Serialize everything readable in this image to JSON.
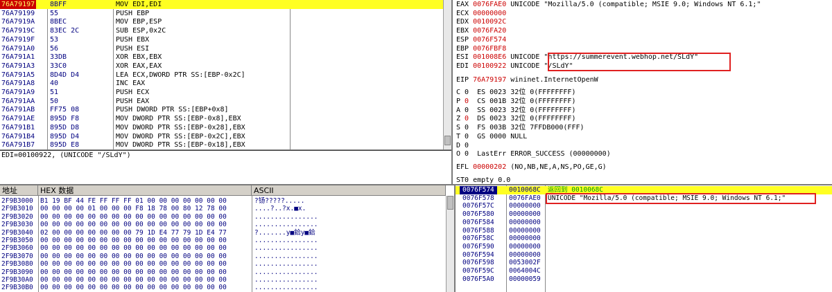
{
  "disasm": {
    "rows": [
      {
        "addr": "76A79197",
        "hex": "8BFF",
        "asm": "MOV EDI,EDI",
        "selected": true
      },
      {
        "addr": "76A79199",
        "hex": "55",
        "asm": "PUSH EBP"
      },
      {
        "addr": "76A7919A",
        "hex": "8BEC",
        "asm": "MOV EBP,ESP"
      },
      {
        "addr": "76A7919C",
        "hex": "83EC 2C",
        "asm": "SUB ESP,0x2C"
      },
      {
        "addr": "76A7919F",
        "hex": "53",
        "asm": "PUSH EBX"
      },
      {
        "addr": "76A791A0",
        "hex": "56",
        "asm": "PUSH ESI"
      },
      {
        "addr": "76A791A1",
        "hex": "33DB",
        "asm": "XOR EBX,EBX"
      },
      {
        "addr": "76A791A3",
        "hex": "33C0",
        "asm": "XOR EAX,EAX"
      },
      {
        "addr": "76A791A5",
        "hex": "8D4D D4",
        "asm": "LEA ECX,DWORD PTR SS:[EBP-0x2C]"
      },
      {
        "addr": "76A791A8",
        "hex": "40",
        "asm": "INC EAX"
      },
      {
        "addr": "76A791A9",
        "hex": "51",
        "asm": "PUSH ECX"
      },
      {
        "addr": "76A791AA",
        "hex": "50",
        "asm": "PUSH EAX"
      },
      {
        "addr": "76A791AB",
        "hex": "FF75 08",
        "asm": "PUSH DWORD PTR SS:[EBP+0x8]"
      },
      {
        "addr": "76A791AE",
        "hex": "895D F8",
        "asm": "MOV DWORD PTR SS:[EBP-0x8],EBX"
      },
      {
        "addr": "76A791B1",
        "hex": "895D D8",
        "asm": "MOV DWORD PTR SS:[EBP-0x28],EBX"
      },
      {
        "addr": "76A791B4",
        "hex": "895D D4",
        "asm": "MOV DWORD PTR SS:[EBP-0x2C],EBX"
      },
      {
        "addr": "76A791B7",
        "hex": "895D E8",
        "asm": "MOV DWORD PTR SS:[EBP-0x18],EBX"
      }
    ]
  },
  "info": {
    "text": "EDI=00100922, (UNICODE \"/SLdY\")"
  },
  "registers": {
    "regs": [
      {
        "name": "EAX",
        "value": "0076FAE0",
        "comment": "UNICODE \"Mozilla/5.0 (compatible; MSIE 9.0; Windows NT 6.1;\""
      },
      {
        "name": "ECX",
        "value": "00000000",
        "comment": ""
      },
      {
        "name": "EDX",
        "value": "0010092C",
        "comment": ""
      },
      {
        "name": "EBX",
        "value": "0076FA20",
        "comment": ""
      },
      {
        "name": "ESP",
        "value": "0076F574",
        "comment": ""
      },
      {
        "name": "EBP",
        "value": "0076FBF8",
        "comment": ""
      },
      {
        "name": "ESI",
        "value": "001008E6",
        "comment": "UNICODE \"https://summerevent.webhop.net/SLdY\""
      },
      {
        "name": "EDI",
        "value": "00100922",
        "comment": "UNICODE \"/SLdY\""
      }
    ],
    "eip": {
      "name": "EIP",
      "value": "76A79197",
      "comment": "wininet.InternetOpenW"
    },
    "flags": [
      {
        "flag": "C",
        "val": "0",
        "seg": "ES",
        "sel": "0023",
        "bits": "32位",
        "base": "0(FFFFFFFF)",
        "red": false
      },
      {
        "flag": "P",
        "val": "0",
        "seg": "CS",
        "sel": "001B",
        "bits": "32位",
        "base": "0(FFFFFFFF)",
        "red": true
      },
      {
        "flag": "A",
        "val": "0",
        "seg": "SS",
        "sel": "0023",
        "bits": "32位",
        "base": "0(FFFFFFFF)",
        "red": false
      },
      {
        "flag": "Z",
        "val": "0",
        "seg": "DS",
        "sel": "0023",
        "bits": "32位",
        "base": "0(FFFFFFFF)",
        "red": true
      },
      {
        "flag": "S",
        "val": "0",
        "seg": "FS",
        "sel": "003B",
        "bits": "32位",
        "base": "7FFDB000(FFF)",
        "red": false
      },
      {
        "flag": "T",
        "val": "0",
        "seg": "GS",
        "sel": "0000",
        "bits": "",
        "base": "NULL",
        "red": false
      },
      {
        "flag": "D",
        "val": "0",
        "seg": "",
        "sel": "",
        "bits": "",
        "base": "",
        "red": false
      },
      {
        "flag": "O",
        "val": "0",
        "seg": "LastErr",
        "sel": "",
        "bits": "",
        "base": "ERROR_SUCCESS (00000000)",
        "red": false
      }
    ],
    "efl": {
      "name": "EFL",
      "value": "00000202",
      "comment": "(NO,NB,NE,A,NS,PO,GE,G)"
    },
    "st0": "ST0 empty 0.0"
  },
  "dump": {
    "headers": {
      "addr": "地址",
      "hex": "HEX 数据",
      "ascii": "ASCII"
    },
    "rows": [
      {
        "addr": "2F9B3000",
        "hex": "B1 19 BF 44 FE FF FF FF 01 00 00 00 00 00 00 00",
        "ascii": "?钖?????....."
      },
      {
        "addr": "2F9B3010",
        "hex": "00 00 00 00 01 00 00 00 F8 18 78 00 80 12 78 00",
        "ascii": "....?..?x.■x."
      },
      {
        "addr": "2F9B3020",
        "hex": "00 00 00 00 00 00 00 00 00 00 00 00 00 00 00 00",
        "ascii": "................"
      },
      {
        "addr": "2F9B3030",
        "hex": "00 00 00 00 00 00 00 00 00 00 00 00 00 00 00 00",
        "ascii": "................"
      },
      {
        "addr": "2F9B3040",
        "hex": "02 00 00 00 00 00 00 00 79 1D E4 77 79 1D E4 77",
        "ascii": "?.......y■鉿y■鉿"
      },
      {
        "addr": "2F9B3050",
        "hex": "00 00 00 00 00 00 00 00 00 00 00 00 00 00 00 00",
        "ascii": "................"
      },
      {
        "addr": "2F9B3060",
        "hex": "00 00 00 00 00 00 00 00 00 00 00 00 00 00 00 00",
        "ascii": "................"
      },
      {
        "addr": "2F9B3070",
        "hex": "00 00 00 00 00 00 00 00 00 00 00 00 00 00 00 00",
        "ascii": "................"
      },
      {
        "addr": "2F9B3080",
        "hex": "00 00 00 00 00 00 00 00 00 00 00 00 00 00 00 00",
        "ascii": "................"
      },
      {
        "addr": "2F9B3090",
        "hex": "00 00 00 00 00 00 00 00 00 00 00 00 00 00 00 00",
        "ascii": "................"
      },
      {
        "addr": "2F9B30A0",
        "hex": "00 00 00 00 00 00 00 00 00 00 00 00 00 00 00 00",
        "ascii": "................"
      },
      {
        "addr": "2F9B30B0",
        "hex": "00 00 00 00 00 00 00 00 00 00 00 00 00 00 00 00",
        "ascii": "................"
      }
    ]
  },
  "stack": {
    "rows": [
      {
        "addr": "0076F574",
        "value": "0010068C",
        "comment": "返回到 0010068C",
        "selected": true
      },
      {
        "addr": "0076F578",
        "value": "0076FAE0",
        "comment": "UNICODE \"Mozilla/5.0 (compatible; MSIE 9.0; Windows NT 6.1;\""
      },
      {
        "addr": "0076F57C",
        "value": "00000000",
        "comment": ""
      },
      {
        "addr": "0076F580",
        "value": "00000000",
        "comment": ""
      },
      {
        "addr": "0076F584",
        "value": "00000000",
        "comment": ""
      },
      {
        "addr": "0076F588",
        "value": "00000000",
        "comment": ""
      },
      {
        "addr": "0076F58C",
        "value": "00000000",
        "comment": ""
      },
      {
        "addr": "0076F590",
        "value": "00000000",
        "comment": ""
      },
      {
        "addr": "0076F594",
        "value": "00000000",
        "comment": ""
      },
      {
        "addr": "0076F598",
        "value": "0053002F",
        "comment": ""
      },
      {
        "addr": "0076F59C",
        "value": "0064004C",
        "comment": ""
      },
      {
        "addr": "0076F5A0",
        "value": "00000059",
        "comment": ""
      }
    ]
  },
  "colors": {
    "highlight": "#ffff22",
    "register_changed": "#cc0000",
    "address": "#000080",
    "annotation_box": "#e02020"
  }
}
